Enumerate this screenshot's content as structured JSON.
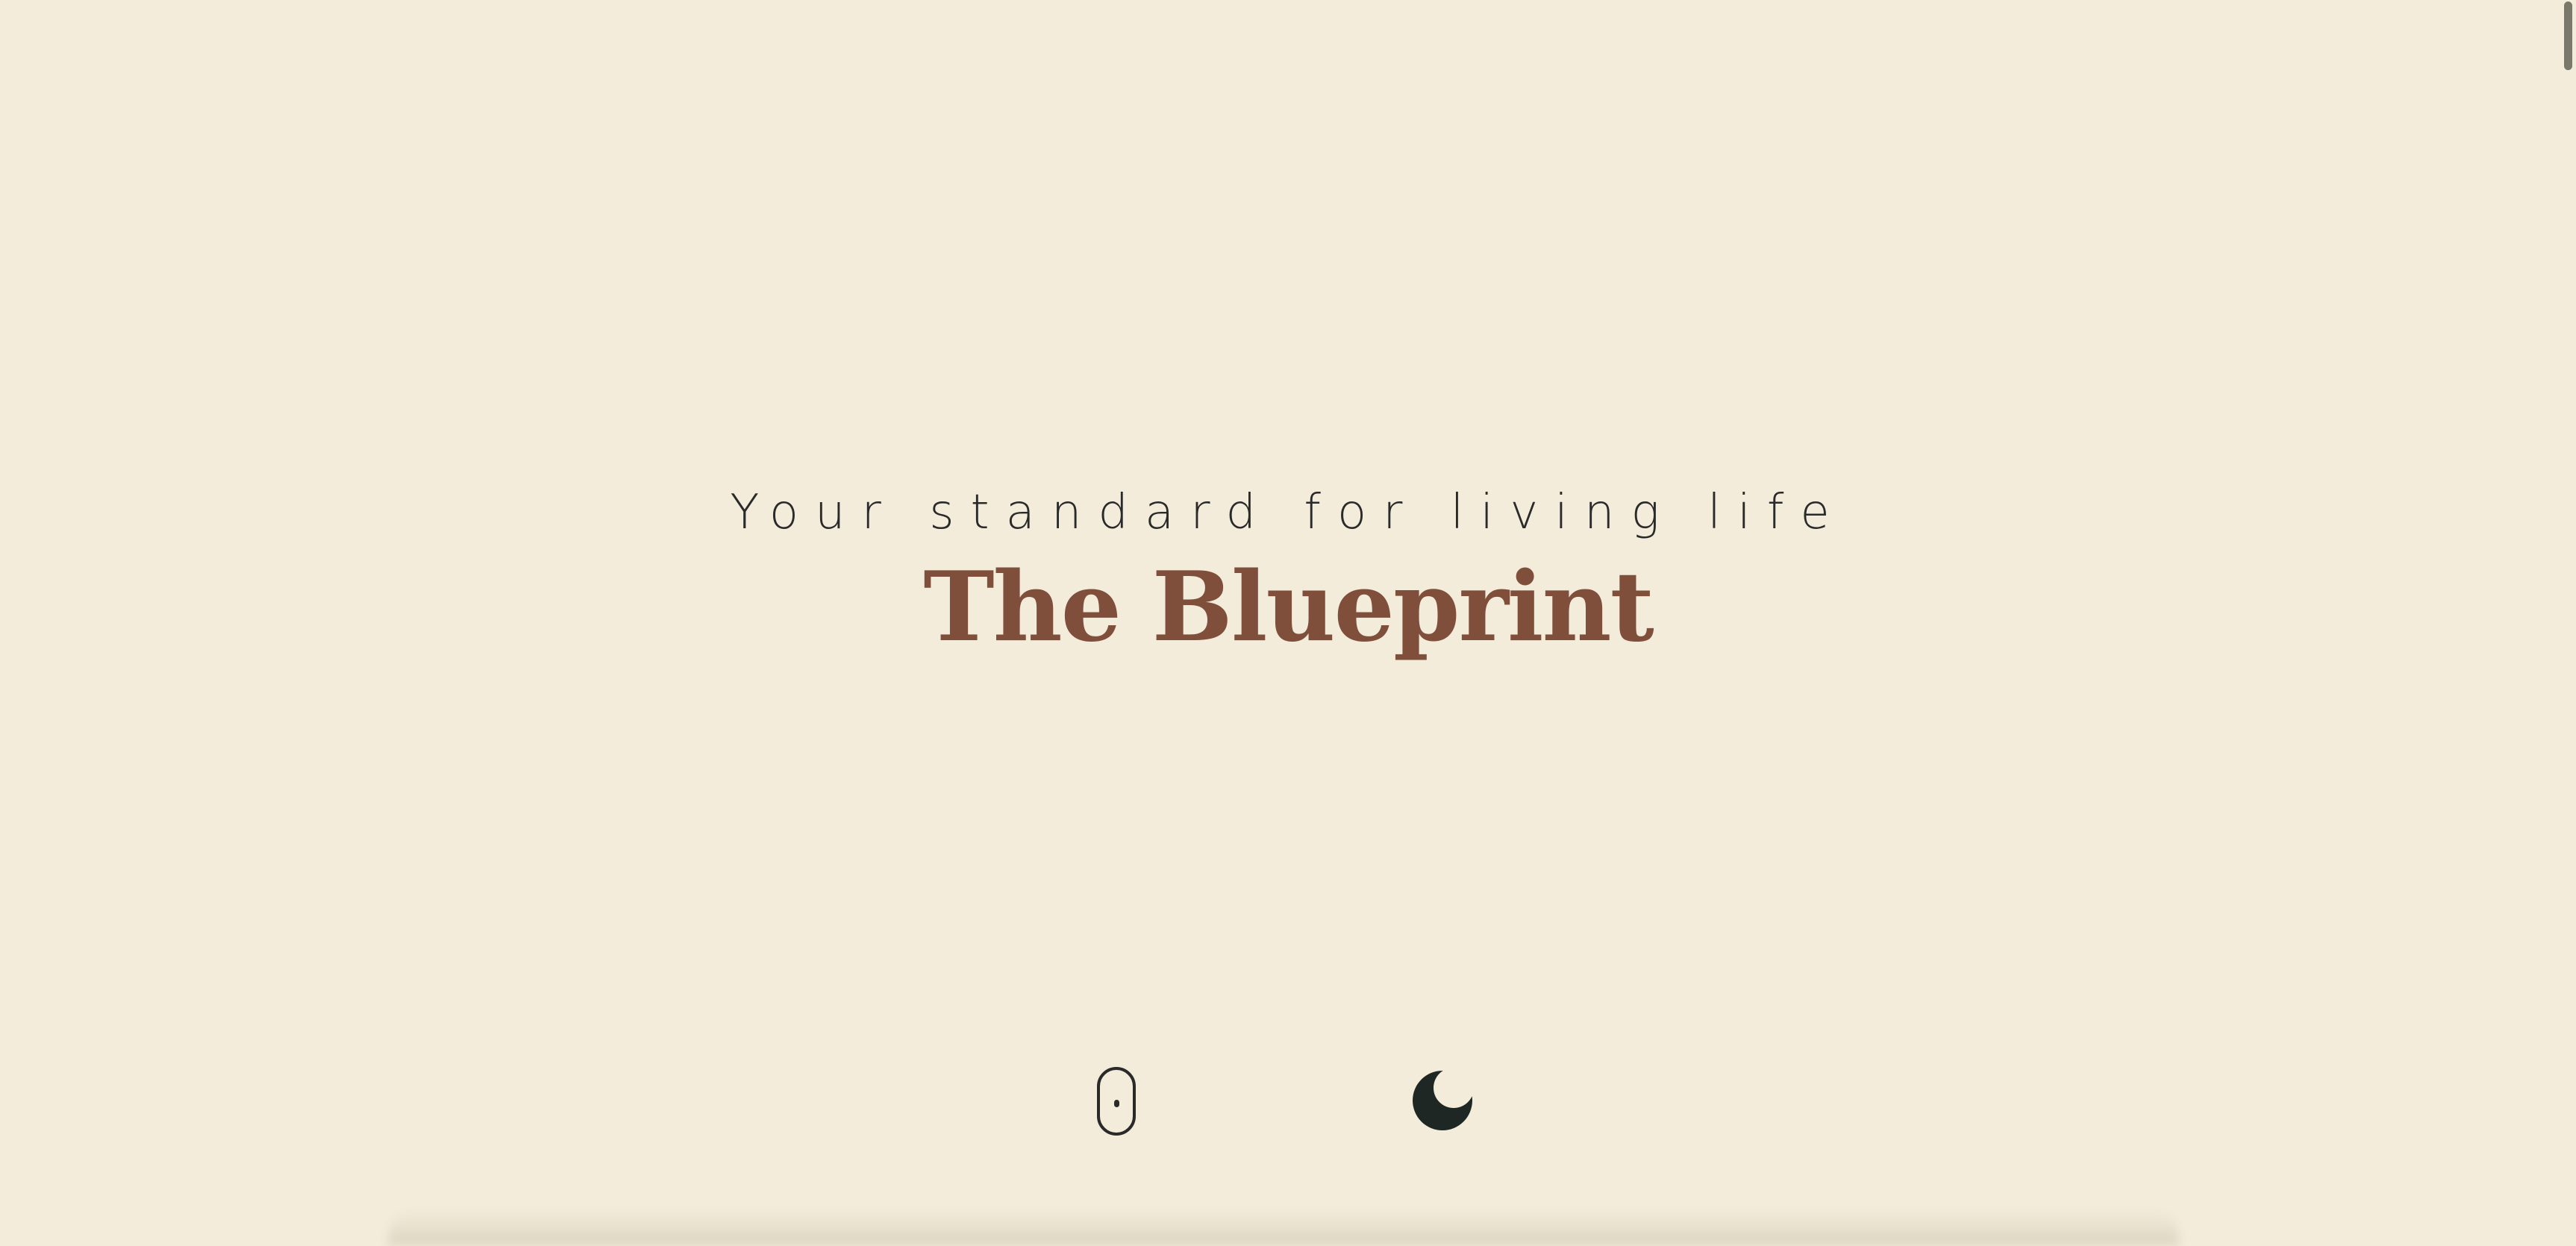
{
  "hero": {
    "tagline": "Your standard for living life",
    "title": "The Blueprint"
  },
  "icons": {
    "scroll": "mouse-scroll-icon",
    "theme": "moon-icon"
  },
  "colors": {
    "background": "#f3ecda",
    "title": "#7f4f3c",
    "text": "#2a2a2a",
    "moon": "#1f2724"
  }
}
